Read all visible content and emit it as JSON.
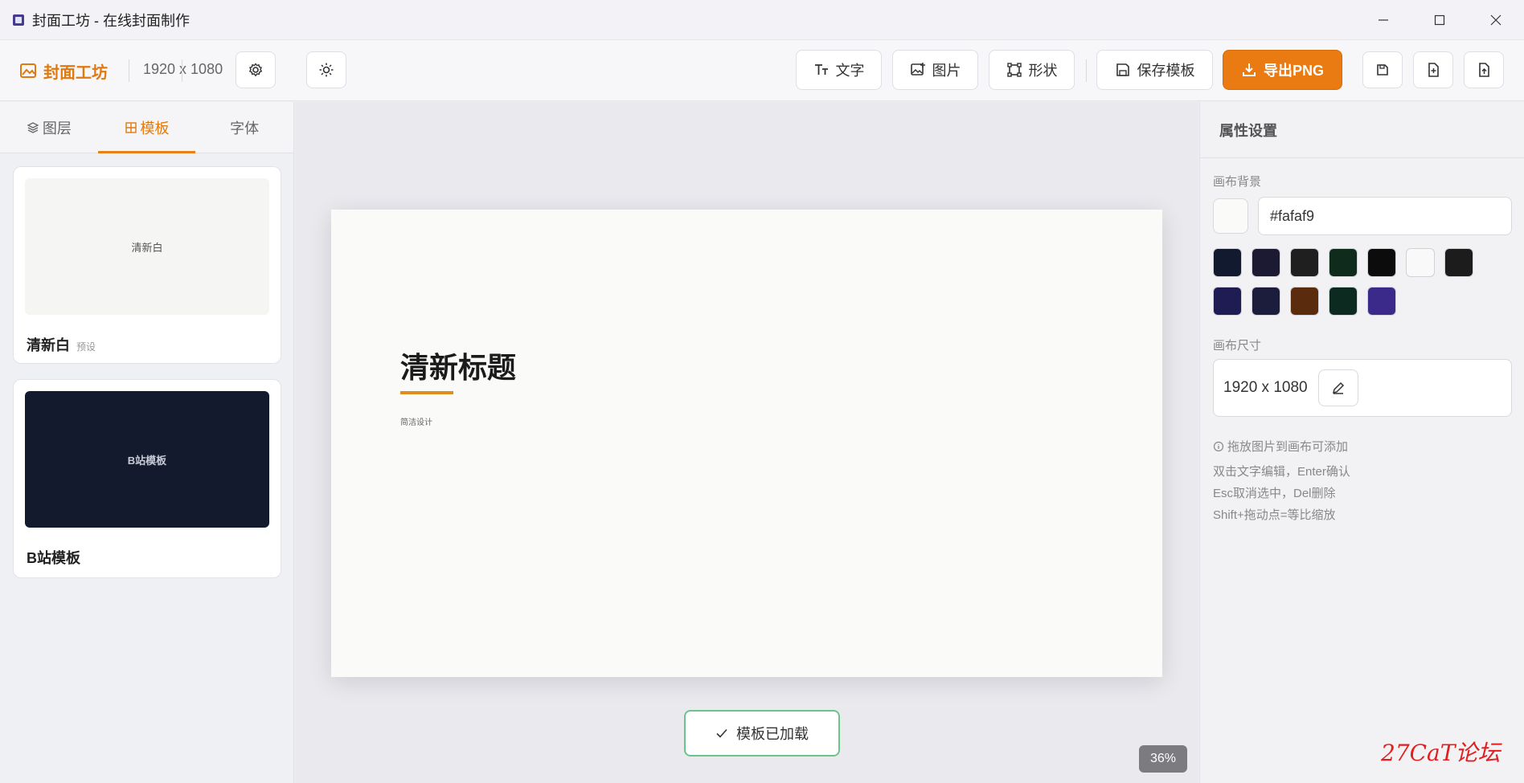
{
  "window": {
    "title": "封面工坊 - 在线封面制作"
  },
  "toolbar": {
    "brand_name": "封面工坊",
    "canvas_size": "1920 x 1080",
    "text_label": "文字",
    "image_label": "图片",
    "shape_label": "形状",
    "save_template_label": "保存模板",
    "export_label": "导出PNG"
  },
  "left_panel": {
    "tabs": [
      {
        "label": "图层",
        "active": false
      },
      {
        "label": "模板",
        "active": true
      },
      {
        "label": "字体",
        "active": false
      }
    ],
    "templates": [
      {
        "name": "清新白",
        "tag": "预设",
        "thumb_text": "清新白",
        "thumb_bg": "#f5f5f4",
        "thumb_fg": "#555555"
      },
      {
        "name": "B站模板",
        "tag": "",
        "thumb_text": "B站模板",
        "thumb_bg": "#131a2e",
        "thumb_fg": "#c8cbd6"
      }
    ]
  },
  "canvas": {
    "title": "清新标题",
    "subtitle": "简洁设计",
    "background": "#fafaf9",
    "accent": "#e08d20"
  },
  "toast": {
    "message": "模板已加载"
  },
  "zoom": {
    "label": "36%"
  },
  "right_panel": {
    "header": "属性设置",
    "bg_label": "画布背景",
    "bg_value": "#fafaf9",
    "swatches": [
      "#111a2e",
      "#1c1a33",
      "#1f1f1f",
      "#0f2b1c",
      "#0c0c0c",
      "#f9f9f9",
      "#1c1c1c",
      "#1e1c52",
      "#1c1c3c",
      "#5a2b0d",
      "#0d2a20",
      "#3b2a8a"
    ],
    "size_label": "画布尺寸",
    "size_value": "1920 x 1080",
    "tips": [
      "拖放图片到画布可添加",
      "双击文字编辑，Enter确认",
      "Esc取消选中，Del删除",
      "Shift+拖动点=等比缩放"
    ]
  },
  "watermark": "27CaT论坛"
}
